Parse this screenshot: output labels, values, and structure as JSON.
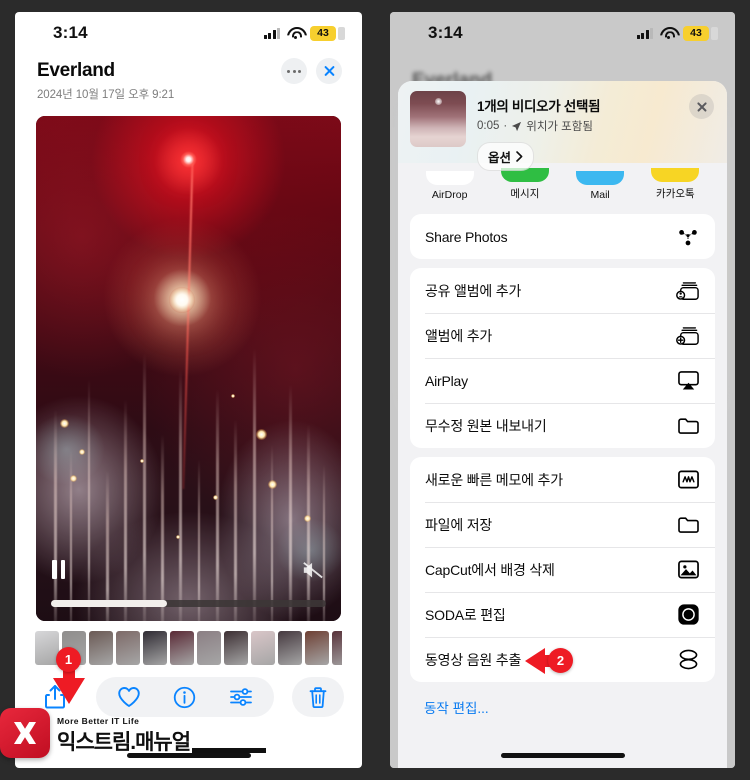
{
  "left_phone": {
    "status_bar": {
      "time": "3:14",
      "battery": "43",
      "battery_color": "#f7cf2e",
      "signal_icon": "cellular-signal-icon",
      "wifi_icon": "wifi-icon"
    },
    "header": {
      "title": "Everland",
      "subtitle": "2024년 10월 17일  오후 9:21",
      "more_icon": "more-options-icon",
      "close_icon": "close-icon"
    },
    "video": {
      "pause_icon": "pause-icon",
      "mute_icon": "mute-icon",
      "progress_percent": 42,
      "scrubber_name": "video-scrubber"
    },
    "toolbar": {
      "share_icon": "share-icon",
      "favorite_icon": "heart-icon",
      "info_icon": "info-icon",
      "adjust_icon": "adjust-sliders-icon",
      "delete_icon": "trash-icon"
    },
    "annotation": {
      "step": "1"
    }
  },
  "right_phone": {
    "status_bar": {
      "time": "3:14",
      "battery": "43",
      "battery_color": "#f7cf2e"
    },
    "backdrop_title": "Everland",
    "share_sheet": {
      "title": "1개의 비디오가 선택됨",
      "subtitle_duration": "0:05",
      "subtitle_separator": "·",
      "subtitle_location": "위치가 포함됨",
      "location_icon": "location-arrow-icon",
      "options_label": "옵션",
      "options_chevron": "chevron-right-icon",
      "close_icon": "close-icon",
      "apps": [
        {
          "label": "AirDrop",
          "color": "#ffffff"
        },
        {
          "label": "메시지",
          "color": "#2fbe43"
        },
        {
          "label": "Mail",
          "color": "#3cb8f0"
        },
        {
          "label": "카카오톡",
          "color": "#f7d524"
        }
      ],
      "groups": [
        {
          "rows": [
            {
              "label": "Share Photos",
              "icon": "share-photos-icon"
            }
          ]
        },
        {
          "rows": [
            {
              "label": "공유 앨범에 추가",
              "icon": "shared-album-add-icon"
            },
            {
              "label": "앨범에 추가",
              "icon": "album-add-icon"
            },
            {
              "label": "AirPlay",
              "icon": "airplay-icon"
            },
            {
              "label": "무수정 원본 내보내기",
              "icon": "folder-icon"
            }
          ]
        },
        {
          "rows": [
            {
              "label": "새로운 빠른 메모에 추가",
              "icon": "quick-note-icon"
            },
            {
              "label": "파일에 저장",
              "icon": "folder-icon"
            },
            {
              "label": "CapCut에서 배경 삭제",
              "icon": "capcut-image-icon"
            },
            {
              "label": "SODA로 편집",
              "icon": "soda-app-icon"
            },
            {
              "label": "동영상 음원 추출",
              "icon": "layers-icon"
            }
          ]
        }
      ],
      "edit_actions_label": "동작 편집..."
    },
    "annotation": {
      "step": "2"
    }
  },
  "watermark": {
    "tagline": "More Better IT Life",
    "brand": "익스트림.매뉴얼",
    "logo_letter": "X",
    "logo_color": "#d61a2b"
  },
  "thumbnails": [
    "#d7d7d9",
    "#8f8d8c",
    "#6b5a55",
    "#7d6a68",
    "#2f2b33",
    "#5a2a36",
    "#8b7f84",
    "#3c2f33",
    "#d9c6c8",
    "#45393f",
    "#6e4034",
    "#58323a",
    "#8c8d90",
    "#b6b7b9",
    "#c9cacc",
    "#e3e1df"
  ]
}
